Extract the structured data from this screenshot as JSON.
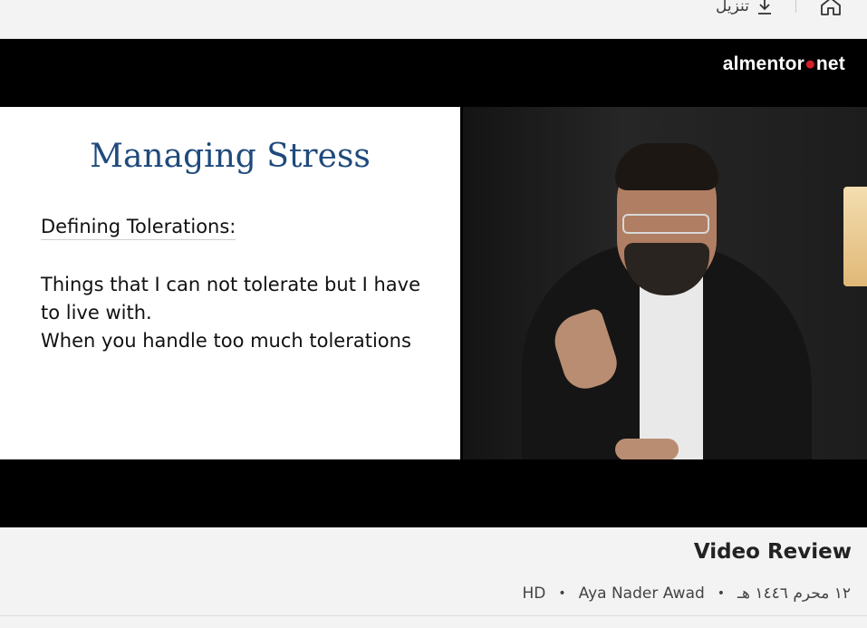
{
  "topbar": {
    "download_label": "تنزيل",
    "home_icon": "home-icon",
    "download_icon": "download-icon"
  },
  "video": {
    "logo_text_pre": "almentor",
    "logo_text_post": "net",
    "slide": {
      "title": "Managing Stress",
      "subtitle": "Defining Tolerations:",
      "line1": "Things that I can not tolerate but I have to live with.",
      "line2": "When you handle too much tolerations"
    }
  },
  "details": {
    "title": "Video Review",
    "date": "١٢ محرم ١٤٤٦ هـ",
    "author": "Aya Nader Awad",
    "quality": "HD"
  },
  "colors": {
    "slide_title": "#1f4a7c",
    "logo_dot": "#d21f2b",
    "page_bg": "#f3f3f3"
  }
}
